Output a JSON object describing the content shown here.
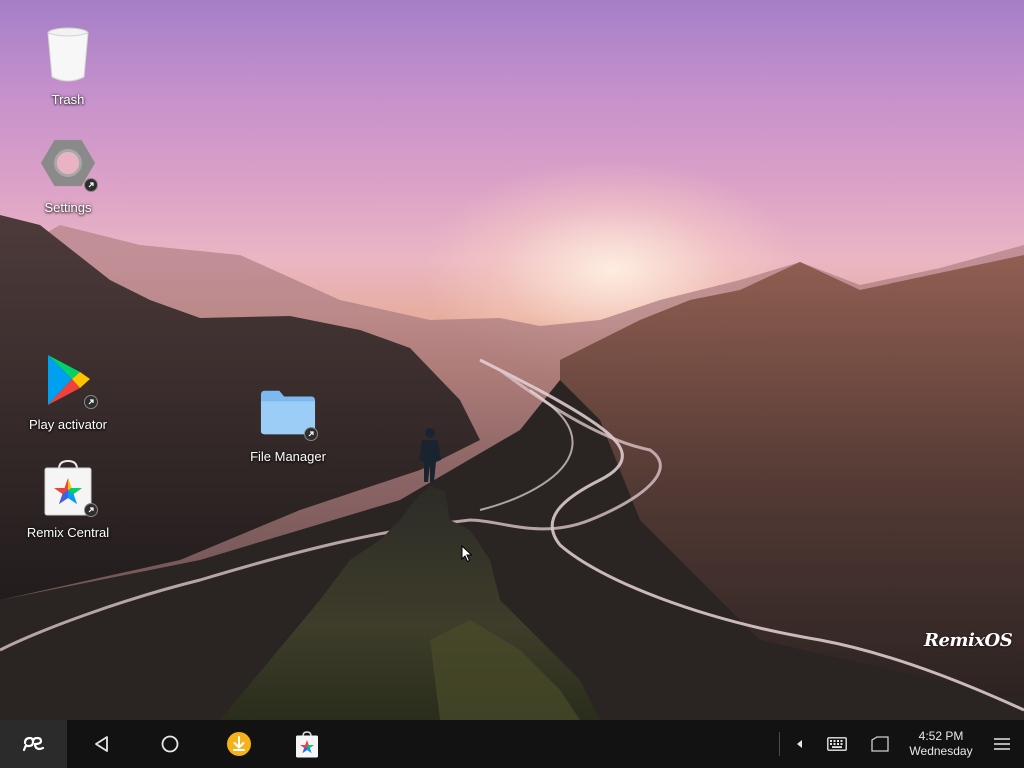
{
  "desktop": {
    "icons": [
      {
        "id": "trash",
        "label": "Trash",
        "icon": "trash-icon"
      },
      {
        "id": "settings",
        "label": "Settings",
        "icon": "settings-icon"
      },
      {
        "id": "play-activator",
        "label": "Play activator",
        "icon": "play-store-icon"
      },
      {
        "id": "remix-central",
        "label": "Remix Central",
        "icon": "remix-central-icon"
      },
      {
        "id": "file-manager",
        "label": "File Manager",
        "icon": "folder-icon"
      }
    ],
    "brand_logo_text": "RemixOS"
  },
  "taskbar": {
    "start_icon": "remix-start-icon",
    "nav": [
      "back-icon",
      "home-icon"
    ],
    "pinned_apps": [
      "download-app-icon",
      "remix-central-app-icon"
    ],
    "tray": [
      "tray-expand-icon",
      "keyboard-icon",
      "signal-icon"
    ],
    "clock": {
      "time": "4:52 PM",
      "day": "Wednesday"
    },
    "notifications_icon": "notifications-menu-icon"
  },
  "colors": {
    "taskbar_bg": "#121212",
    "start_bg": "#2b2b2b",
    "download_badge": "#f6b21b",
    "folder": "#8fc6f5"
  }
}
